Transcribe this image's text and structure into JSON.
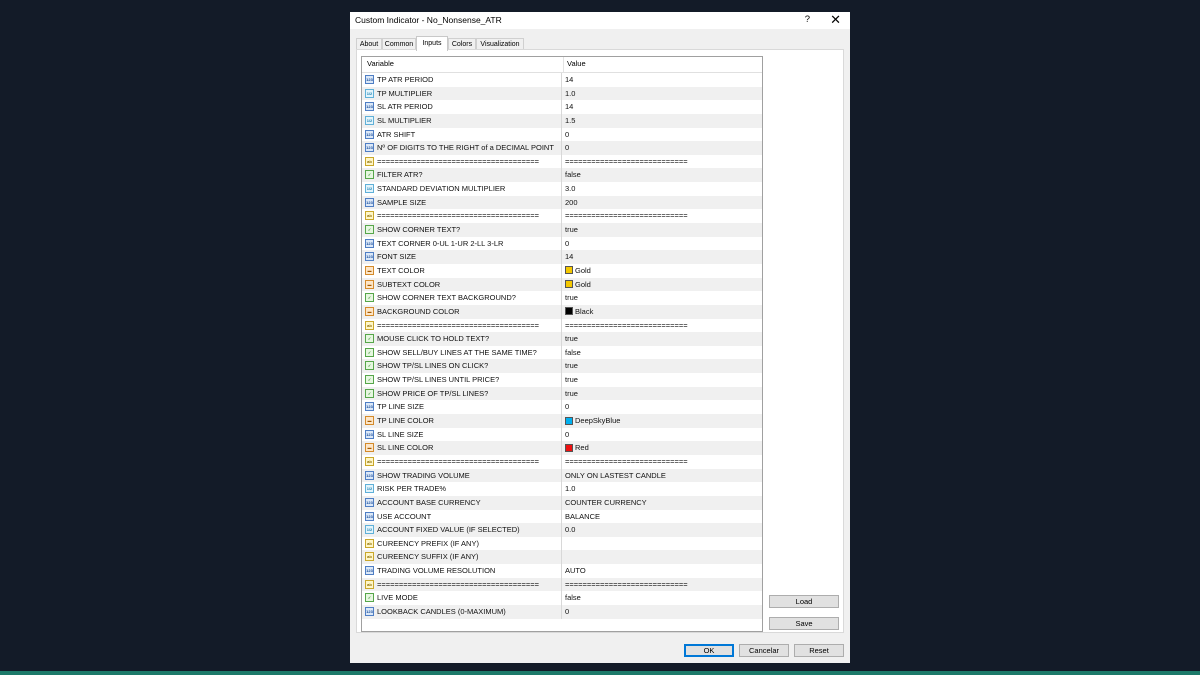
{
  "window": {
    "title": "Custom Indicator - No_Nonsense_ATR",
    "help_label": "?",
    "close_label": "✕"
  },
  "tabs": [
    {
      "label": "About"
    },
    {
      "label": "Common"
    },
    {
      "label": "Inputs",
      "active": true
    },
    {
      "label": "Colors"
    },
    {
      "label": "Visualization"
    }
  ],
  "table": {
    "headers": {
      "variable": "Variable",
      "value": "Value"
    },
    "rows": [
      {
        "type": "int",
        "variable": "TP ATR PERIOD",
        "value": "14"
      },
      {
        "type": "dbl",
        "variable": "TP MULTIPLIER",
        "value": "1.0"
      },
      {
        "type": "int",
        "variable": "SL ATR PERIOD",
        "value": "14"
      },
      {
        "type": "dbl",
        "variable": "SL MULTIPLIER",
        "value": "1.5"
      },
      {
        "type": "int",
        "variable": "ATR SHIFT",
        "value": "0"
      },
      {
        "type": "int",
        "variable": "Nº OF DIGITS TO THE RIGHT of a DECIMAL POINT",
        "value": "0"
      },
      {
        "type": "str",
        "variable": "=====================================",
        "value": "============================"
      },
      {
        "type": "bool",
        "variable": "FILTER ATR?",
        "value": "false"
      },
      {
        "type": "dbl",
        "variable": "STANDARD DEVIATION MULTIPLIER",
        "value": "3.0"
      },
      {
        "type": "int",
        "variable": "SAMPLE SIZE",
        "value": "200"
      },
      {
        "type": "str",
        "variable": "=====================================",
        "value": "============================"
      },
      {
        "type": "bool",
        "variable": "SHOW CORNER TEXT?",
        "value": "true"
      },
      {
        "type": "int",
        "variable": "TEXT CORNER 0-UL 1-UR 2-LL 3-LR",
        "value": "0"
      },
      {
        "type": "int",
        "variable": "FONT SIZE",
        "value": "14"
      },
      {
        "type": "clr",
        "variable": "TEXT COLOR",
        "value": "Gold",
        "swatch": "#f5c800"
      },
      {
        "type": "clr",
        "variable": "SUBTEXT COLOR",
        "value": "Gold",
        "swatch": "#f5c800"
      },
      {
        "type": "bool",
        "variable": "SHOW CORNER TEXT BACKGROUND?",
        "value": "true"
      },
      {
        "type": "clr",
        "variable": "BACKGROUND COLOR",
        "value": "Black",
        "swatch": "#000000"
      },
      {
        "type": "str",
        "variable": "=====================================",
        "value": "============================"
      },
      {
        "type": "bool",
        "variable": "MOUSE CLICK TO HOLD TEXT?",
        "value": "true"
      },
      {
        "type": "bool",
        "variable": "SHOW SELL/BUY LINES AT THE SAME TIME?",
        "value": "false"
      },
      {
        "type": "bool",
        "variable": "SHOW TP/SL LINES ON CLICK?",
        "value": "true"
      },
      {
        "type": "bool",
        "variable": "SHOW TP/SL LINES UNTIL PRICE?",
        "value": "true"
      },
      {
        "type": "bool",
        "variable": "SHOW PRICE OF TP/SL LINES?",
        "value": "true"
      },
      {
        "type": "int",
        "variable": "TP LINE SIZE",
        "value": "0"
      },
      {
        "type": "clr",
        "variable": "TP LINE COLOR",
        "value": "DeepSkyBlue",
        "swatch": "#00b0f0"
      },
      {
        "type": "int",
        "variable": "SL LINE SIZE",
        "value": "0"
      },
      {
        "type": "clr",
        "variable": "SL LINE COLOR",
        "value": "Red",
        "swatch": "#ee1111"
      },
      {
        "type": "str",
        "variable": "=====================================",
        "value": "============================"
      },
      {
        "type": "int",
        "variable": "SHOW TRADING VOLUME",
        "value": "ONLY ON LASTEST CANDLE"
      },
      {
        "type": "dbl",
        "variable": "RISK PER TRADE%",
        "value": "1.0"
      },
      {
        "type": "int",
        "variable": "ACCOUNT BASE CURRENCY",
        "value": "COUNTER CURRENCY"
      },
      {
        "type": "int",
        "variable": "USE ACCOUNT",
        "value": "BALANCE"
      },
      {
        "type": "dbl",
        "variable": "ACCOUNT FIXED VALUE (IF SELECTED)",
        "value": "0.0"
      },
      {
        "type": "str",
        "variable": "CUREENCY PREFIX (IF ANY)",
        "value": ""
      },
      {
        "type": "str",
        "variable": "CUREENCY SUFFIX (IF ANY)",
        "value": ""
      },
      {
        "type": "int",
        "variable": "TRADING VOLUME RESOLUTION",
        "value": "AUTO"
      },
      {
        "type": "str",
        "variable": "=====================================",
        "value": "============================"
      },
      {
        "type": "bool",
        "variable": "LIVE MODE",
        "value": "false"
      },
      {
        "type": "int",
        "variable": "LOOKBACK CANDLES (0-MAXIMUM)",
        "value": "0"
      }
    ]
  },
  "icons": {
    "int": {
      "name": "integer-type-icon",
      "glyph": "123"
    },
    "dbl": {
      "name": "double-type-icon",
      "glyph": "1/2"
    },
    "bool": {
      "name": "bool-type-icon",
      "glyph": "✓"
    },
    "str": {
      "name": "string-type-icon",
      "glyph": "ab"
    },
    "clr": {
      "name": "color-type-icon",
      "glyph": "▬"
    }
  },
  "side_buttons": {
    "load": "Load",
    "save": "Save"
  },
  "footer_buttons": {
    "ok": "OK",
    "cancel": "Cancelar",
    "reset": "Reset"
  }
}
